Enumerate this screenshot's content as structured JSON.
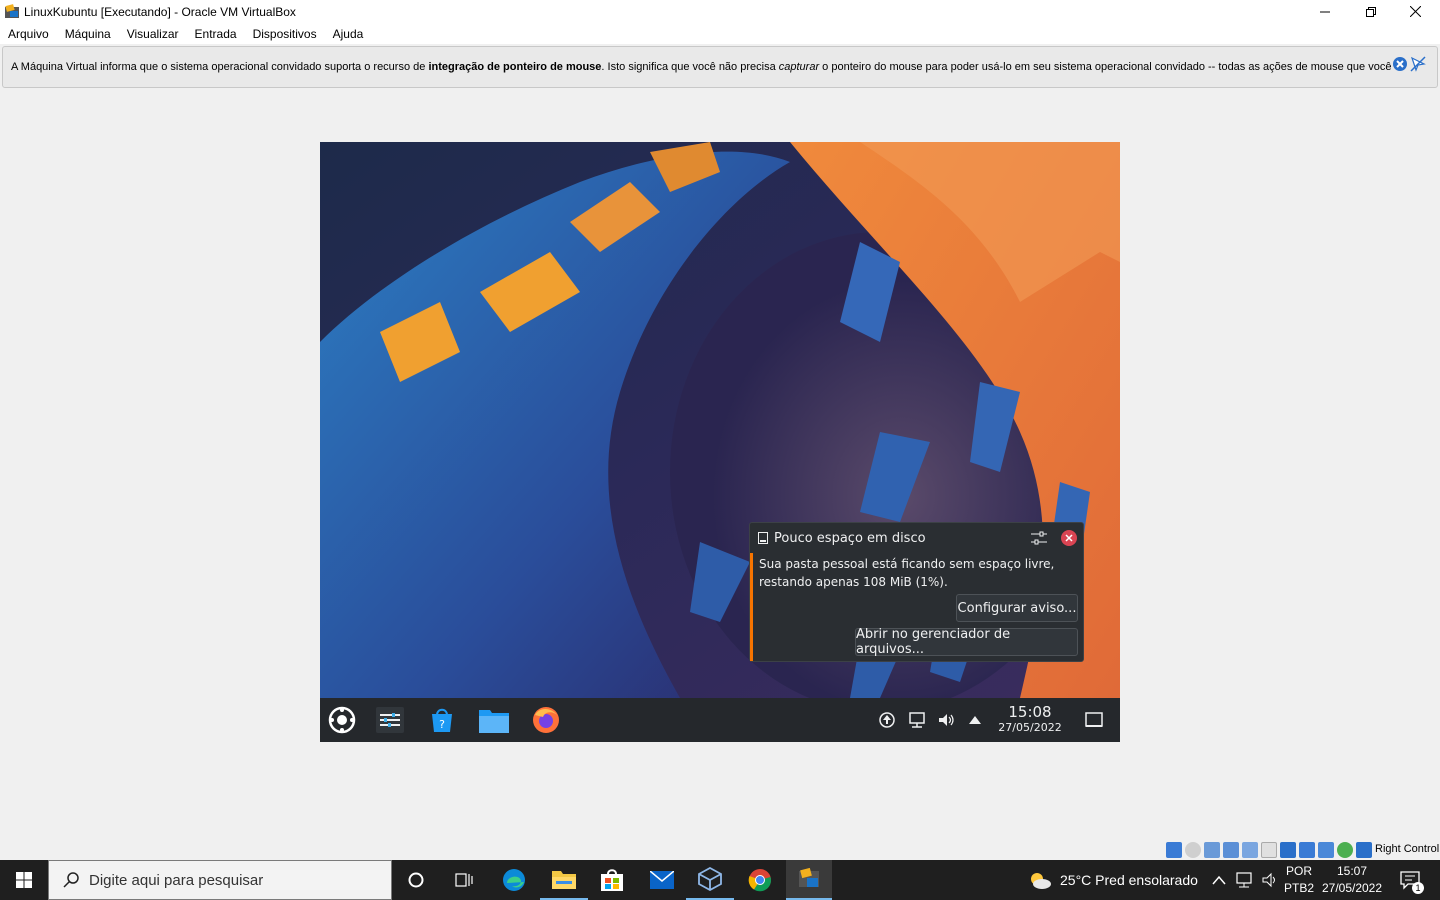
{
  "window": {
    "title": "LinuxKubuntu [Executando] - Oracle VM VirtualBox",
    "minimize": "—",
    "restore": "❐",
    "close": "✕"
  },
  "menu": [
    "Arquivo",
    "Máquina",
    "Visualizar",
    "Entrada",
    "Dispositivos",
    "Ajuda"
  ],
  "infobar": {
    "pre": "A Máquina Virtual informa que o sistema operacional convidado suporta o recurso de ",
    "bold": "integração de ponteiro de mouse",
    "mid": ". Isto significa que você não precisa ",
    "italic": "capturar",
    "post": " o ponteiro do mouse para poder usá-lo em seu sistema operacional convidado -- todas as ações de mouse que você"
  },
  "notification": {
    "title": "Pouco espaço em disco",
    "body_line1": "Sua pasta pessoal está ficando sem espaço livre,",
    "body_line2": "restando apenas 108 MiB (1%).",
    "button_configure": "Configurar aviso...",
    "button_open": "Abrir no gerenciador de arquivos..."
  },
  "guest_panel": {
    "time": "15:08",
    "date": "27/05/2022"
  },
  "statusbar": {
    "host_key": "Right Control"
  },
  "taskbar": {
    "search_placeholder": "Digite aqui para pesquisar",
    "weather": "25°C  Pred ensolarado",
    "lang1": "POR",
    "lang2": "PTB2",
    "time": "15:07",
    "date": "27/05/2022",
    "notif_count": "1"
  },
  "colors": {
    "kde_orange": "#f67400",
    "panel_bg": "#25282c",
    "taskbar_bg": "#1f1f1f"
  }
}
